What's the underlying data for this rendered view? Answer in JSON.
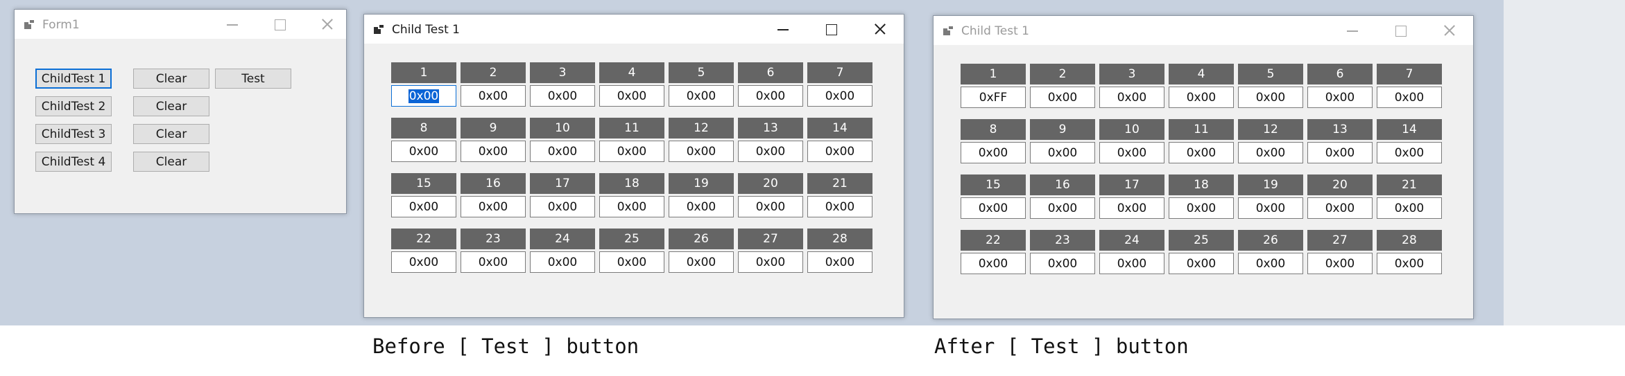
{
  "form1": {
    "title": "Form1",
    "buttons": {
      "childtest1": "ChildTest 1",
      "childtest2": "ChildTest 2",
      "childtest3": "ChildTest 3",
      "childtest4": "ChildTest 4",
      "clear1": "Clear",
      "clear2": "Clear",
      "clear3": "Clear",
      "clear4": "Clear",
      "test": "Test"
    }
  },
  "child_before": {
    "title": "Child Test 1",
    "cells": [
      {
        "label": "1",
        "value": "0x00"
      },
      {
        "label": "2",
        "value": "0x00"
      },
      {
        "label": "3",
        "value": "0x00"
      },
      {
        "label": "4",
        "value": "0x00"
      },
      {
        "label": "5",
        "value": "0x00"
      },
      {
        "label": "6",
        "value": "0x00"
      },
      {
        "label": "7",
        "value": "0x00"
      },
      {
        "label": "8",
        "value": "0x00"
      },
      {
        "label": "9",
        "value": "0x00"
      },
      {
        "label": "10",
        "value": "0x00"
      },
      {
        "label": "11",
        "value": "0x00"
      },
      {
        "label": "12",
        "value": "0x00"
      },
      {
        "label": "13",
        "value": "0x00"
      },
      {
        "label": "14",
        "value": "0x00"
      },
      {
        "label": "15",
        "value": "0x00"
      },
      {
        "label": "16",
        "value": "0x00"
      },
      {
        "label": "17",
        "value": "0x00"
      },
      {
        "label": "18",
        "value": "0x00"
      },
      {
        "label": "19",
        "value": "0x00"
      },
      {
        "label": "20",
        "value": "0x00"
      },
      {
        "label": "21",
        "value": "0x00"
      },
      {
        "label": "22",
        "value": "0x00"
      },
      {
        "label": "23",
        "value": "0x00"
      },
      {
        "label": "24",
        "value": "0x00"
      },
      {
        "label": "25",
        "value": "0x00"
      },
      {
        "label": "26",
        "value": "0x00"
      },
      {
        "label": "27",
        "value": "0x00"
      },
      {
        "label": "28",
        "value": "0x00"
      }
    ]
  },
  "child_after": {
    "title": "Child Test 1",
    "cells": [
      {
        "label": "1",
        "value": "0xFF"
      },
      {
        "label": "2",
        "value": "0x00"
      },
      {
        "label": "3",
        "value": "0x00"
      },
      {
        "label": "4",
        "value": "0x00"
      },
      {
        "label": "5",
        "value": "0x00"
      },
      {
        "label": "6",
        "value": "0x00"
      },
      {
        "label": "7",
        "value": "0x00"
      },
      {
        "label": "8",
        "value": "0x00"
      },
      {
        "label": "9",
        "value": "0x00"
      },
      {
        "label": "10",
        "value": "0x00"
      },
      {
        "label": "11",
        "value": "0x00"
      },
      {
        "label": "12",
        "value": "0x00"
      },
      {
        "label": "13",
        "value": "0x00"
      },
      {
        "label": "14",
        "value": "0x00"
      },
      {
        "label": "15",
        "value": "0x00"
      },
      {
        "label": "16",
        "value": "0x00"
      },
      {
        "label": "17",
        "value": "0x00"
      },
      {
        "label": "18",
        "value": "0x00"
      },
      {
        "label": "19",
        "value": "0x00"
      },
      {
        "label": "20",
        "value": "0x00"
      },
      {
        "label": "21",
        "value": "0x00"
      },
      {
        "label": "22",
        "value": "0x00"
      },
      {
        "label": "23",
        "value": "0x00"
      },
      {
        "label": "24",
        "value": "0x00"
      },
      {
        "label": "25",
        "value": "0x00"
      },
      {
        "label": "26",
        "value": "0x00"
      },
      {
        "label": "27",
        "value": "0x00"
      },
      {
        "label": "28",
        "value": "0x00"
      }
    ]
  },
  "captions": {
    "before": "Before [ Test ] button",
    "after": "After [ Test ] button"
  },
  "colors": {
    "desktop": "#c7d1df",
    "cell_label_bg": "#656565",
    "focus_blue": "#0b6fd6"
  },
  "icons": [
    "app-icon",
    "minimize-icon",
    "maximize-icon",
    "close-icon"
  ]
}
